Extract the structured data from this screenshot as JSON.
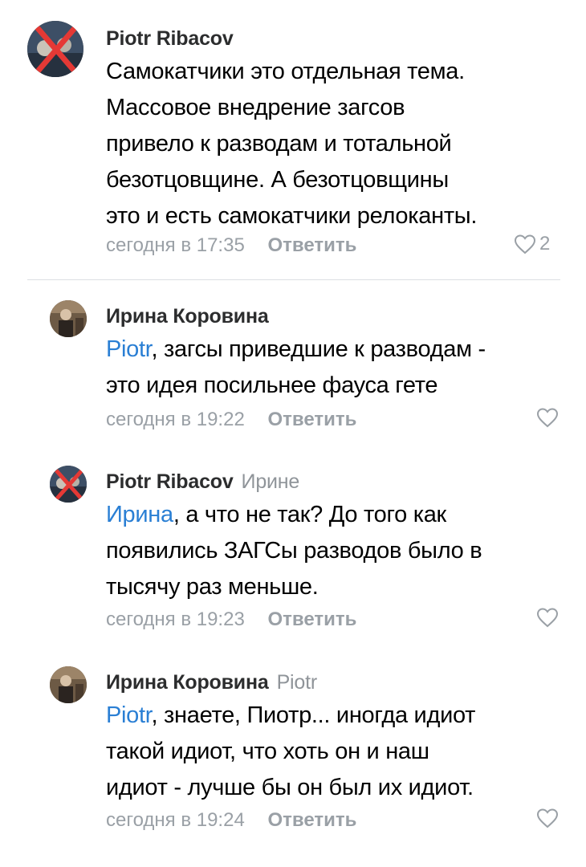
{
  "comments": [
    {
      "author": "Piotr Ribacov",
      "reply_to": "",
      "mention": "",
      "lines": [
        "Самокатчики это отдельная тема.",
        "Массовое внедрение загсов",
        "привело к разводам и тотальной",
        "безотцовщине. А безотцовщины",
        "это и есть самокатчики релоканты."
      ],
      "time": "сегодня в 17:35",
      "reply_label": "Ответить",
      "likes": "2"
    },
    {
      "author": "Ирина Коровина",
      "reply_to": "",
      "mention": "Piotr",
      "lines": [
        ", загсы приведшие к разводам -",
        "это идея посильнее фауса гете"
      ],
      "time": "сегодня в 19:22",
      "reply_label": "Ответить",
      "likes": ""
    },
    {
      "author": "Piotr Ribacov",
      "reply_to": "Ирине",
      "mention": "Ирина",
      "lines": [
        ", а что не так? До того как",
        "появились ЗАГСы разводов было в",
        "тысячу раз меньше."
      ],
      "time": "сегодня в 19:23",
      "reply_label": "Ответить",
      "likes": ""
    },
    {
      "author": "Ирина Коровина",
      "reply_to": "Piotr",
      "mention": "Piotr",
      "lines": [
        ", знаете, Пиотр... иногда идиот",
        "такой идиот, что хоть он и наш",
        "идиот - лучше бы он был их идиот."
      ],
      "time": "сегодня в 19:24",
      "reply_label": "Ответить",
      "likes": ""
    }
  ],
  "colors": {
    "mention": "#2a7fd4",
    "meta": "#9aa0a6",
    "author": "#2c2d2e",
    "avatar_cross": "#e53935"
  },
  "icons": {
    "like": "heart-outline-icon",
    "avatar_overlay": "red-cross-mark"
  }
}
